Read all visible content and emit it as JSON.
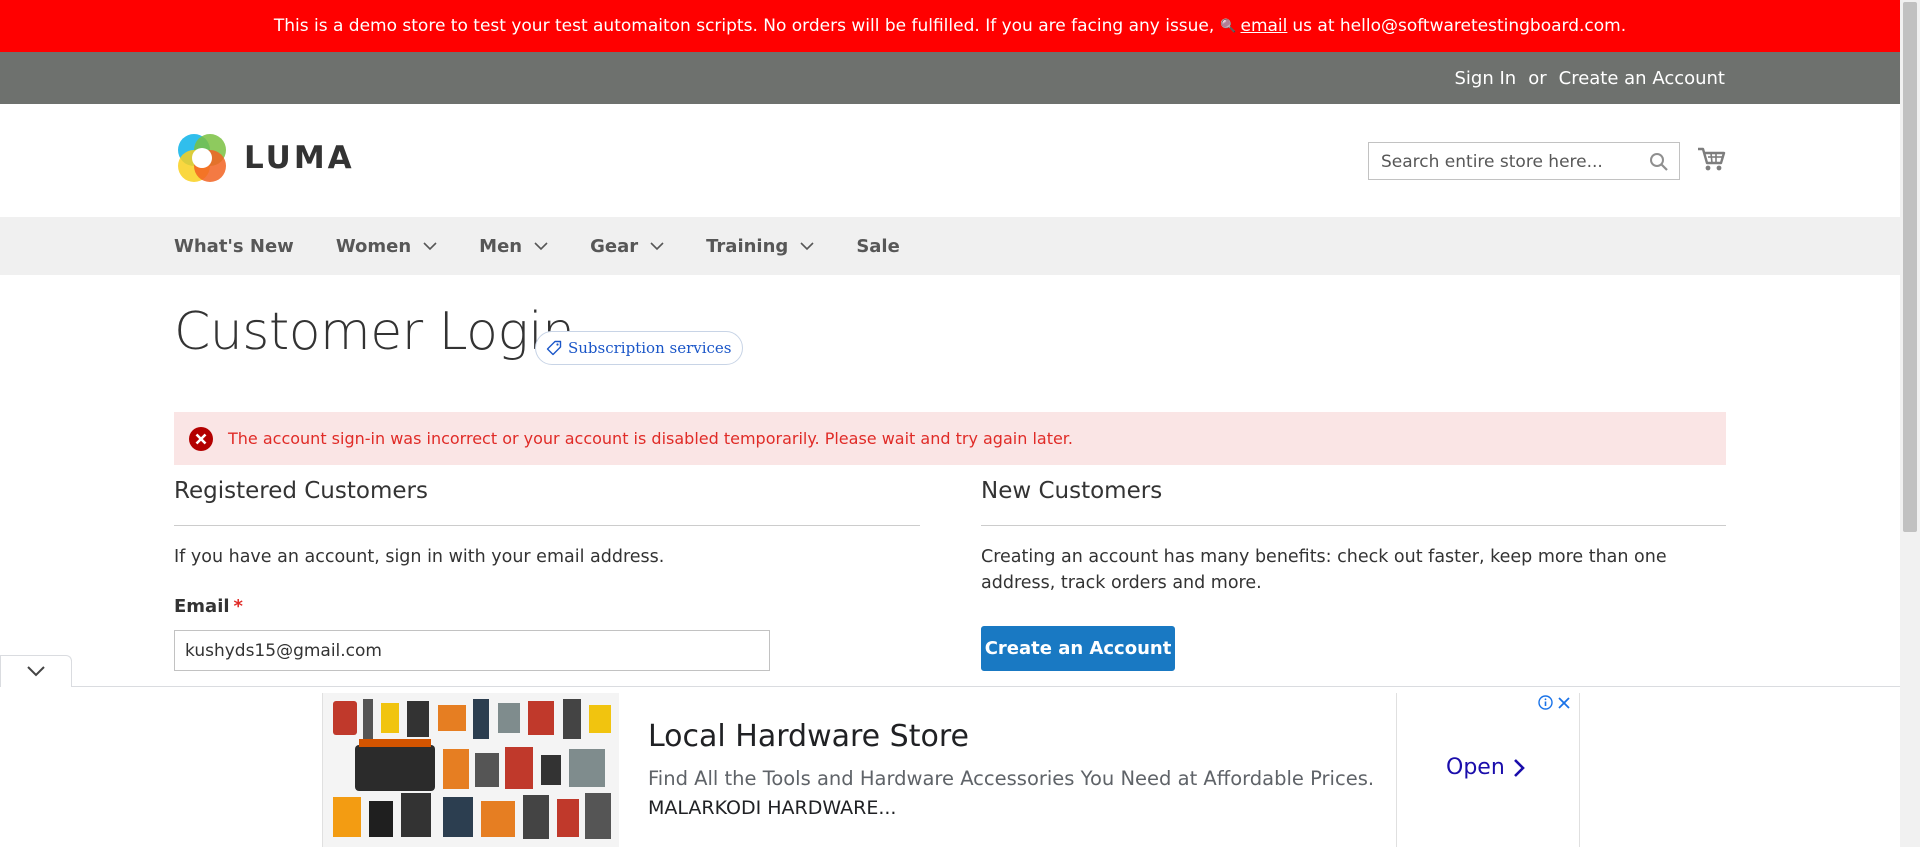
{
  "demo_notice": {
    "text_before": "This is a demo store to test your test automaiton scripts. No orders will be fulfilled. If you are facing any issue,",
    "link_text": "email",
    "text_after": "us at hello@softwaretestingboard.com."
  },
  "header_links": {
    "sign_in": "Sign In",
    "or": "or",
    "create_account": "Create an Account"
  },
  "logo": {
    "text": "LUMA"
  },
  "search": {
    "placeholder": "Search entire store here..."
  },
  "nav": {
    "items": [
      {
        "label": "What's New",
        "has_dropdown": false
      },
      {
        "label": "Women",
        "has_dropdown": true
      },
      {
        "label": "Men",
        "has_dropdown": true
      },
      {
        "label": "Gear",
        "has_dropdown": true
      },
      {
        "label": "Training",
        "has_dropdown": true
      },
      {
        "label": "Sale",
        "has_dropdown": false
      }
    ]
  },
  "page": {
    "title": "Customer Login",
    "subscription_badge": "Subscription services",
    "error_message": "The account sign-in was incorrect or your account is disabled temporarily. Please wait and try again later."
  },
  "registered": {
    "title": "Registered Customers",
    "intro": "If you have an account, sign in with your email address.",
    "email_label": "Email",
    "required_mark": "*",
    "email_value": "kushyds15@gmail.com"
  },
  "new_customers": {
    "title": "New Customers",
    "text": "Creating an account has many benefits: check out faster, keep more than one address, track orders and more.",
    "button": "Create an Account"
  },
  "ad": {
    "title": "Local Hardware Store",
    "description": "Find All the Tools and Hardware Accessories You Need at Affordable Prices.",
    "advertiser": "MALARKODI HARDWARE...",
    "cta": "Open"
  },
  "colors": {
    "demo_bar": "#ff0000",
    "header_panel": "#6e716e",
    "nav_bg": "#f0f0f0",
    "error_bg": "#fae5e5",
    "error_text": "#e02b27",
    "primary_button": "#1979c3"
  }
}
